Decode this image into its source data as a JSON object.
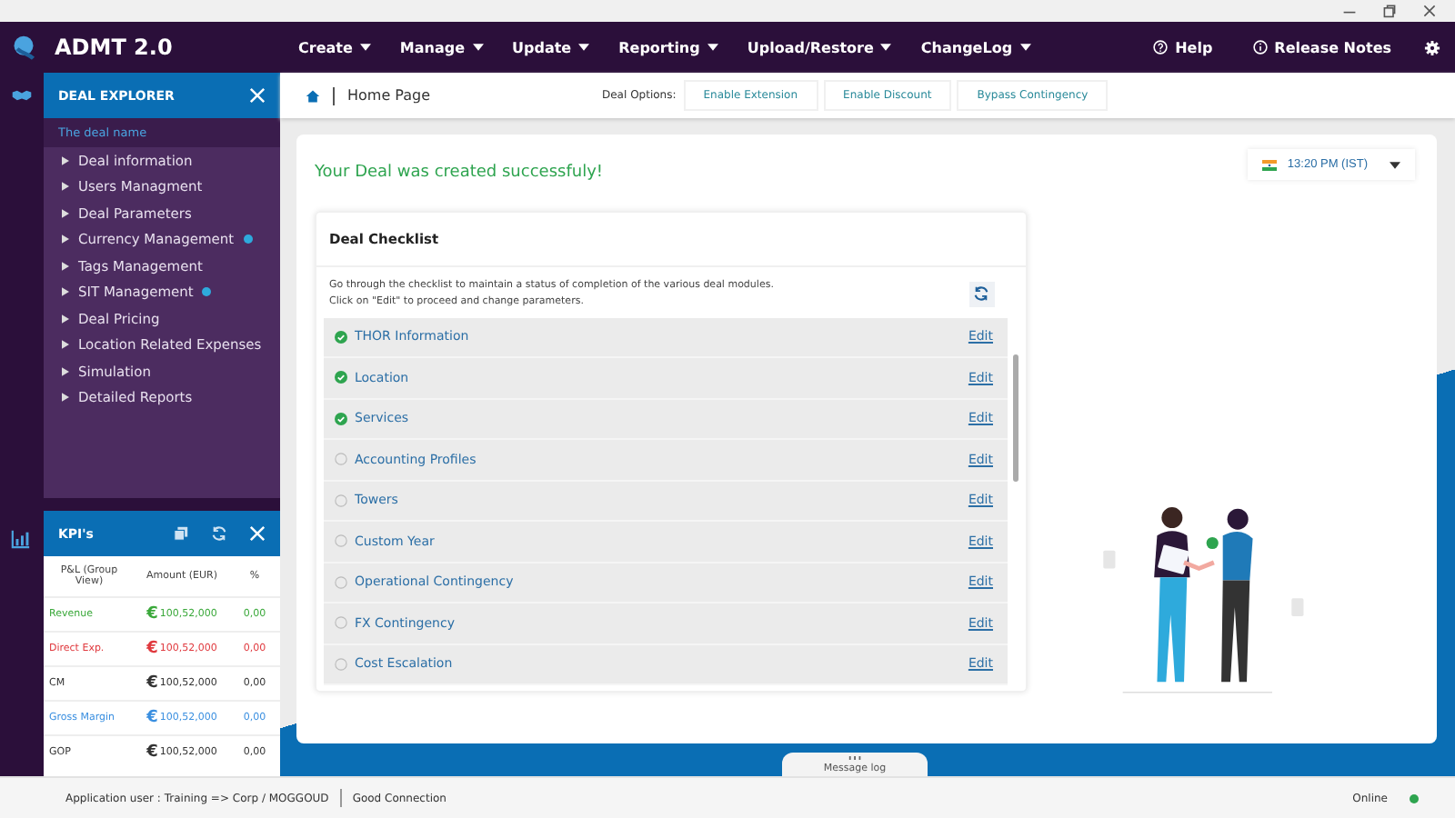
{
  "app": {
    "title": "ADMT 2.0"
  },
  "nav": {
    "menus": [
      {
        "label": "Create"
      },
      {
        "label": "Manage"
      },
      {
        "label": "Update"
      },
      {
        "label": "Reporting"
      },
      {
        "label": "Upload/Restore"
      },
      {
        "label": "ChangeLog"
      }
    ],
    "help": "Help",
    "release_notes": "Release Notes"
  },
  "explorer": {
    "title": "DEAL EXPLORER",
    "deal_name": "The deal name",
    "items": [
      {
        "label": "Deal information",
        "marked": false
      },
      {
        "label": "Users Managment",
        "marked": false
      },
      {
        "label": "Deal Parameters",
        "marked": false
      },
      {
        "label": "Currency  Management",
        "marked": true
      },
      {
        "label": "Tags Management",
        "marked": false
      },
      {
        "label": "SIT  Management",
        "marked": true
      },
      {
        "label": "Deal Pricing",
        "marked": false
      },
      {
        "label": "Location Related Expenses",
        "marked": false
      },
      {
        "label": "Simulation",
        "marked": false
      },
      {
        "label": "Detailed Reports",
        "marked": false
      }
    ]
  },
  "kpis": {
    "title": "KPI's",
    "columns": [
      "P&L (Group View)",
      "Amount (EUR)",
      "%"
    ],
    "rows": [
      {
        "name": "Revenue",
        "currency": "€",
        "amount": "100,52,000",
        "percent": "0,00",
        "color": "#3aa83a"
      },
      {
        "name": "Direct Exp.",
        "currency": "€",
        "amount": "100,52,000",
        "percent": "0,00",
        "color": "#e0393e"
      },
      {
        "name": "CM",
        "currency": "€",
        "amount": "100,52,000",
        "percent": "0,00",
        "color": "#333333"
      },
      {
        "name": "Gross Margin",
        "currency": "€",
        "amount": "100,52,000",
        "percent": "0,00",
        "color": "#3a8fe0"
      },
      {
        "name": "GOP",
        "currency": "€",
        "amount": "100,52,000",
        "percent": "0,00",
        "color": "#333333"
      }
    ]
  },
  "breadcrumb": "Home Page",
  "deal_options": {
    "label": "Deal Options:",
    "buttons": [
      "Enable Extension",
      "Enable Discount",
      "Bypass Contingency"
    ]
  },
  "success_message": "Your Deal was created successfuly!",
  "timezone": "13:20 PM (IST)",
  "checklist": {
    "title": "Deal Checklist",
    "description": [
      "Go through the checklist to maintain a status of completion of the various deal modules.",
      "Click on \"Edit\" to proceed and  change  parameters."
    ],
    "items": [
      {
        "label": "THOR Information",
        "done": true,
        "action": "Edit"
      },
      {
        "label": "Location",
        "done": true,
        "action": "Edit"
      },
      {
        "label": "Services",
        "done": true,
        "action": "Edit"
      },
      {
        "label": "Accounting Profiles",
        "done": false,
        "action": "Edit"
      },
      {
        "label": "Towers",
        "done": false,
        "action": "Edit"
      },
      {
        "label": "Custom Year",
        "done": false,
        "action": "Edit"
      },
      {
        "label": "Operational Contingency",
        "done": false,
        "action": "Edit"
      },
      {
        "label": "FX Contingency",
        "done": false,
        "action": "Edit"
      },
      {
        "label": "Cost Escalation",
        "done": false,
        "action": "Edit"
      }
    ]
  },
  "message_log": "Message log",
  "status_bar": {
    "user": "Application user : Training => Corp / MOGGOUD",
    "connection": "Good Connection",
    "online": "Online"
  }
}
